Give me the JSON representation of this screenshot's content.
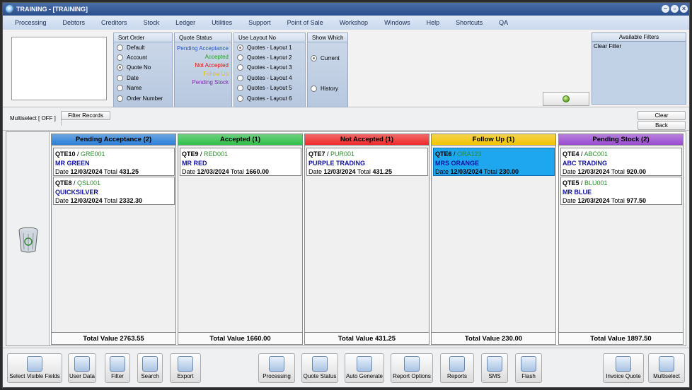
{
  "window": {
    "title": "TRAINING - [TRAINING]"
  },
  "menu": [
    "Processing",
    "Debtors",
    "Creditors",
    "Stock",
    "Ledger",
    "Utilities",
    "Support",
    "Point of Sale",
    "Workshop",
    "Windows",
    "Help",
    "Shortcuts",
    "QA"
  ],
  "sort_order": {
    "header": "Sort Order",
    "options": [
      "Default",
      "Account",
      "Quote No",
      "Date",
      "Name",
      "Order Number"
    ],
    "selected": "Quote No"
  },
  "quote_status": {
    "header": "Quote Status",
    "items": [
      {
        "label": "Pending Acceptance",
        "color": "#2255cc"
      },
      {
        "label": "Accepted",
        "color": "#22a022"
      },
      {
        "label": "Not Accepted",
        "color": "#e01010"
      },
      {
        "label": "Follow Up",
        "color": "#e8c000"
      },
      {
        "label": "Pending Stock",
        "color": "#7a2aa8"
      }
    ]
  },
  "layout": {
    "header": "Use Layout No",
    "options": [
      "Quotes - Layout 1",
      "Quotes - Layout 2",
      "Quotes - Layout 3",
      "Quotes - Layout 4",
      "Quotes - Layout 5",
      "Quotes - Layout 6"
    ],
    "selected": "Quotes - Layout 1"
  },
  "show_which": {
    "header": "Show Which",
    "options": [
      "Current",
      "History"
    ],
    "selected": "Current"
  },
  "available_filters": {
    "header": "Available Filters",
    "clear_label": "Clear Filter"
  },
  "toolrow": {
    "multiselect": "Multiselect [ OFF ]",
    "filter_records": "Filter Records",
    "clear": "Clear",
    "back": "Back"
  },
  "columns": [
    {
      "title": "Pending Acceptance (2)",
      "color": "#2a7fd8",
      "total": "Total Value 2763.55",
      "cards": [
        {
          "qno": "QTE10",
          "acc": "GRE001",
          "cust": "MR GREEN",
          "date": "12/03/2024",
          "total": "431.25"
        },
        {
          "qno": "QTE8",
          "acc": "QSL001",
          "cust": "QUICKSILVER",
          "date": "12/03/2024",
          "total": "2332.30"
        }
      ]
    },
    {
      "title": "Accepted (1)",
      "color": "#2fc048",
      "total": "Total Value 1660.00",
      "cards": [
        {
          "qno": "QTE9",
          "acc": "RED001",
          "cust": "MR RED",
          "date": "12/03/2024",
          "total": "1660.00"
        }
      ]
    },
    {
      "title": "Not Accepted (1)",
      "color": "#f02828",
      "total": "Total Value 431.25",
      "cards": [
        {
          "qno": "QTE7",
          "acc": "PUR001",
          "cust": "PURPLE TRADING",
          "date": "12/03/2024",
          "total": "431.25"
        }
      ]
    },
    {
      "title": "Follow Up (1)",
      "color": "#f5c400",
      "total": "Total Value 230.00",
      "cards": [
        {
          "qno": "QTE6",
          "acc": "ORA123",
          "cust": "MRS ORANGE",
          "date": "12/03/2024",
          "total": "230.00"
        }
      ]
    },
    {
      "title": "Pending Stock (2)",
      "color": "#9a4ad0",
      "total": "Total Value 1897.50",
      "cards": [
        {
          "qno": "QTE4",
          "acc": "ABC001",
          "cust": "ABC TRADING",
          "date": "12/03/2024",
          "total": "920.00"
        },
        {
          "qno": "QTE5",
          "acc": "BLU001",
          "cust": "MR BLUE",
          "date": "12/03/2024",
          "total": "977.50"
        }
      ]
    }
  ],
  "labels": {
    "date": "Date",
    "total": "Total"
  },
  "bottom": {
    "select_fields": "Select Visible Fields",
    "user_data": "User Data",
    "filter": "Filter",
    "search": "Search",
    "export": "Export",
    "processing": "Processing",
    "quote_status": "Quote Status",
    "auto_generate": "Auto Generate",
    "report_options": "Report Options",
    "reports": "Reports",
    "sms": "SMS",
    "flash": "Flash",
    "invoice_quote": "Invoice Quote",
    "multiselect": "Multiselect"
  }
}
